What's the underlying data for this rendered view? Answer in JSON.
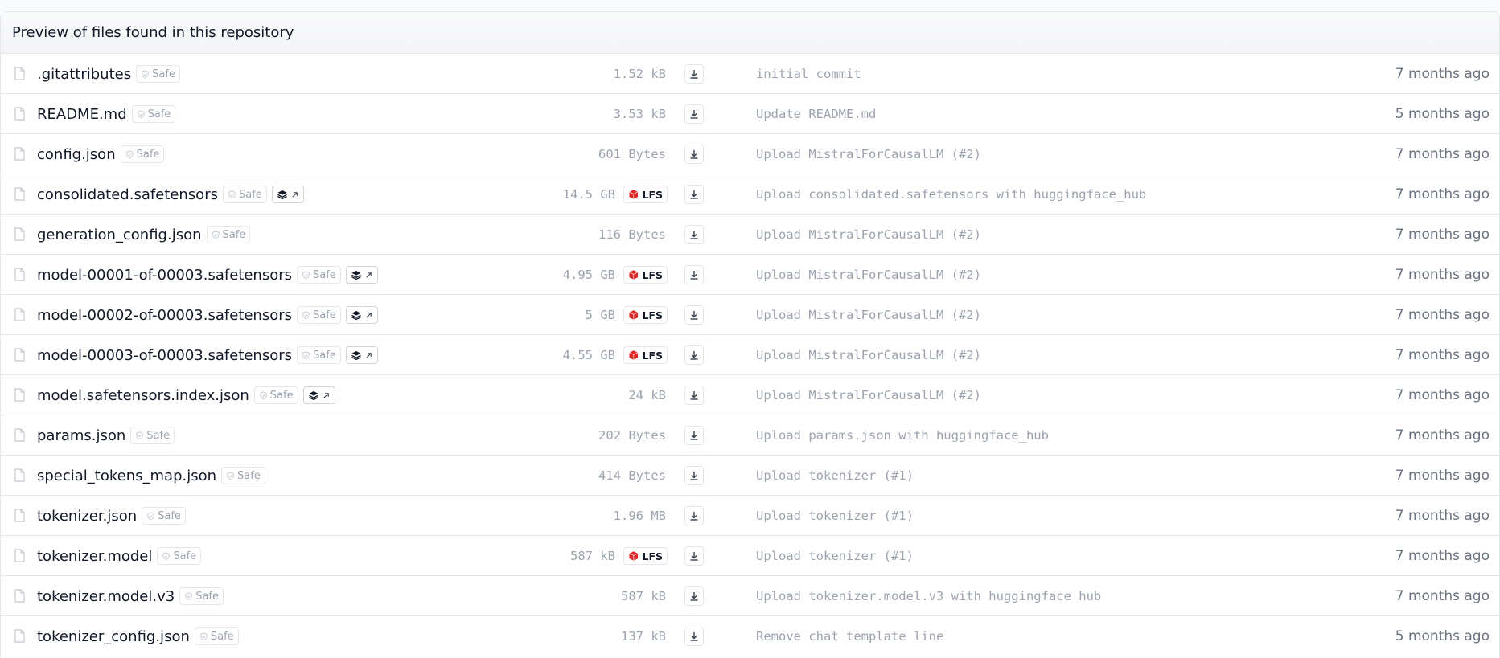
{
  "header": {
    "title": "Preview of files found in this repository"
  },
  "icons": {
    "file": "file-icon",
    "safe": "shield-check-icon",
    "xet": "xet-stack-icon",
    "external": "arrow-up-right-icon",
    "lfs": "lfs-box-icon",
    "download": "download-icon"
  },
  "colors": {
    "lfs_icon": "#dc2626",
    "muted_text": "#9ca3af",
    "border": "#e5e7eb"
  },
  "files": [
    {
      "name": ".gitattributes",
      "safe": "Safe",
      "xet": false,
      "size": "1.52 kB",
      "lfs": "",
      "commit": "initial commit",
      "date": "7 months ago"
    },
    {
      "name": "README.md",
      "safe": "Safe",
      "xet": false,
      "size": "3.53 kB",
      "lfs": "",
      "commit": "Update README.md",
      "date": "5 months ago"
    },
    {
      "name": "config.json",
      "safe": "Safe",
      "xet": false,
      "size": "601 Bytes",
      "lfs": "",
      "commit": "Upload MistralForCausalLM (#2)",
      "date": "7 months ago"
    },
    {
      "name": "consolidated.safetensors",
      "safe": "Safe",
      "xet": true,
      "size": "14.5 GB",
      "lfs": "LFS",
      "commit": "Upload consolidated.safetensors with huggingface_hub",
      "date": "7 months ago"
    },
    {
      "name": "generation_config.json",
      "safe": "Safe",
      "xet": false,
      "size": "116 Bytes",
      "lfs": "",
      "commit": "Upload MistralForCausalLM (#2)",
      "date": "7 months ago"
    },
    {
      "name": "model-00001-of-00003.safetensors",
      "safe": "Safe",
      "xet": true,
      "size": "4.95 GB",
      "lfs": "LFS",
      "commit": "Upload MistralForCausalLM (#2)",
      "date": "7 months ago"
    },
    {
      "name": "model-00002-of-00003.safetensors",
      "safe": "Safe",
      "xet": true,
      "size": "5 GB",
      "lfs": "LFS",
      "commit": "Upload MistralForCausalLM (#2)",
      "date": "7 months ago"
    },
    {
      "name": "model-00003-of-00003.safetensors",
      "safe": "Safe",
      "xet": true,
      "size": "4.55 GB",
      "lfs": "LFS",
      "commit": "Upload MistralForCausalLM (#2)",
      "date": "7 months ago"
    },
    {
      "name": "model.safetensors.index.json",
      "safe": "Safe",
      "xet": true,
      "size": "24 kB",
      "lfs": "",
      "commit": "Upload MistralForCausalLM (#2)",
      "date": "7 months ago"
    },
    {
      "name": "params.json",
      "safe": "Safe",
      "xet": false,
      "size": "202 Bytes",
      "lfs": "",
      "commit": "Upload params.json with huggingface_hub",
      "date": "7 months ago"
    },
    {
      "name": "special_tokens_map.json",
      "safe": "Safe",
      "xet": false,
      "size": "414 Bytes",
      "lfs": "",
      "commit": "Upload tokenizer (#1)",
      "date": "7 months ago"
    },
    {
      "name": "tokenizer.json",
      "safe": "Safe",
      "xet": false,
      "size": "1.96 MB",
      "lfs": "",
      "commit": "Upload tokenizer (#1)",
      "date": "7 months ago"
    },
    {
      "name": "tokenizer.model",
      "safe": "Safe",
      "xet": false,
      "size": "587 kB",
      "lfs": "LFS",
      "commit": "Upload tokenizer (#1)",
      "date": "7 months ago"
    },
    {
      "name": "tokenizer.model.v3",
      "safe": "Safe",
      "xet": false,
      "size": "587 kB",
      "lfs": "",
      "commit": "Upload tokenizer.model.v3 with huggingface_hub",
      "date": "7 months ago"
    },
    {
      "name": "tokenizer_config.json",
      "safe": "Safe",
      "xet": false,
      "size": "137 kB",
      "lfs": "",
      "commit": "Remove chat template line",
      "date": "5 months ago"
    }
  ]
}
